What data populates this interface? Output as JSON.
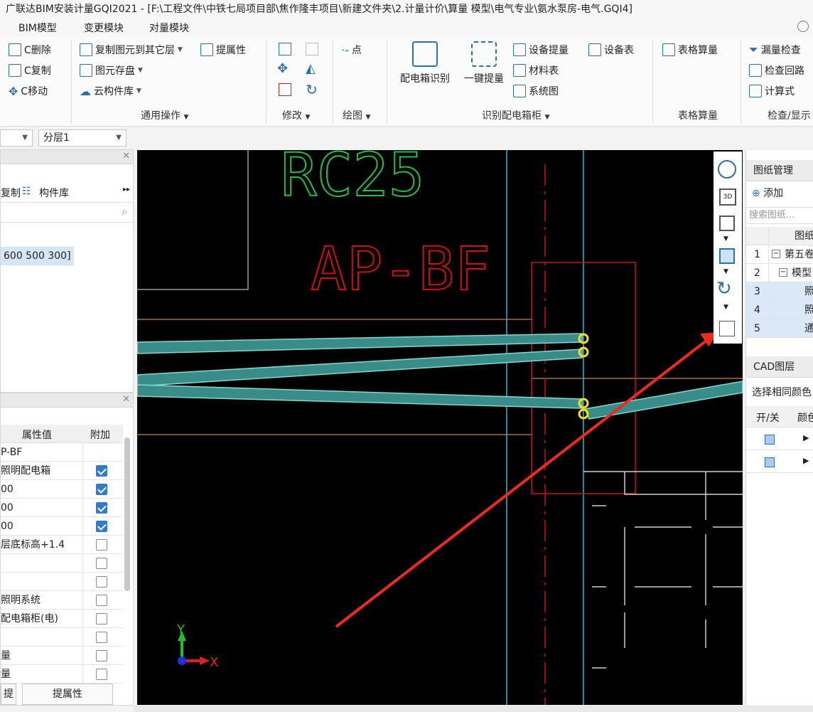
{
  "app": {
    "title": "广联达BIM安装计量GQI2021 - [F:\\工程文件\\中铁七局项目部\\焦作隆丰项目\\新建文件夹\\2.计量计价\\算量 模型\\电气专业\\氨水泵房-电气.GQI4]"
  },
  "menu": [
    "BIM模型",
    "变更模块",
    "对量模块"
  ],
  "ribbon": {
    "edit": {
      "delete": "C删除",
      "copy": "C复制",
      "move": "C移动"
    },
    "common": {
      "copy_to_floor": "复制图元到其它层",
      "save_elem": "图元存盘",
      "cloud_lib": "云构件库",
      "extract_prop": "提属性",
      "group": "通用操作"
    },
    "modify": {
      "group": "修改"
    },
    "draw": {
      "point": "点",
      "group": "绘图"
    },
    "identify": {
      "box_identify": "配电箱识别",
      "one_click": "一键提量",
      "device_extract": "设备提量",
      "material_table": "材料表",
      "system_diagram": "系统图",
      "device_table": "设备表",
      "group": "识别配电箱柜"
    },
    "table": {
      "table_calc": "表格算量",
      "group": "表格算量"
    },
    "check": {
      "leak_check": "漏量检查",
      "check_loop": "检查回路",
      "formula": "计算式",
      "group": "检查/显示"
    }
  },
  "toolbar2": {
    "layer_select": "分层1"
  },
  "left_top": {
    "tab_copy": "复制",
    "tab_lib": "构件库",
    "selected_item": "600 500 300]"
  },
  "left_bottom": {
    "col_value": "属性值",
    "col_extra": "附加",
    "rows": [
      {
        "value": "P-BF",
        "checked": null
      },
      {
        "value": "照明配电箱",
        "checked": true
      },
      {
        "value": "00",
        "checked": true
      },
      {
        "value": "00",
        "checked": true
      },
      {
        "value": "00",
        "checked": true
      },
      {
        "value": "层底标高+1.4",
        "checked": false
      },
      {
        "value": "",
        "checked": false
      },
      {
        "value": "",
        "checked": false
      },
      {
        "value": "照明系统",
        "checked": false
      },
      {
        "value": "配电箱柜(电)",
        "checked": false
      },
      {
        "value": "",
        "checked": false
      },
      {
        "value": "量",
        "checked": false
      },
      {
        "value": "量",
        "checked": false
      }
    ],
    "btn_left": "提",
    "btn_extract": "提属性"
  },
  "canvas": {
    "label_rc": "RC25",
    "label_ap": "AP-BF",
    "axis_y": "Y",
    "axis_x": "X"
  },
  "right": {
    "drawing_mgmt": "图纸管理",
    "add": "添加",
    "search_placeholder": "搜索图纸...",
    "col_drawing": "图纸",
    "rows": [
      {
        "n": "1",
        "t": "第五卷"
      },
      {
        "n": "2",
        "t": "模型"
      },
      {
        "n": "3",
        "t": "照"
      },
      {
        "n": "4",
        "t": "照"
      },
      {
        "n": "5",
        "t": "通"
      }
    ],
    "cad_layer": "CAD图层",
    "select_same_color": "选择相同颜色",
    "col_onoff": "开/关",
    "col_color": "颜色"
  }
}
